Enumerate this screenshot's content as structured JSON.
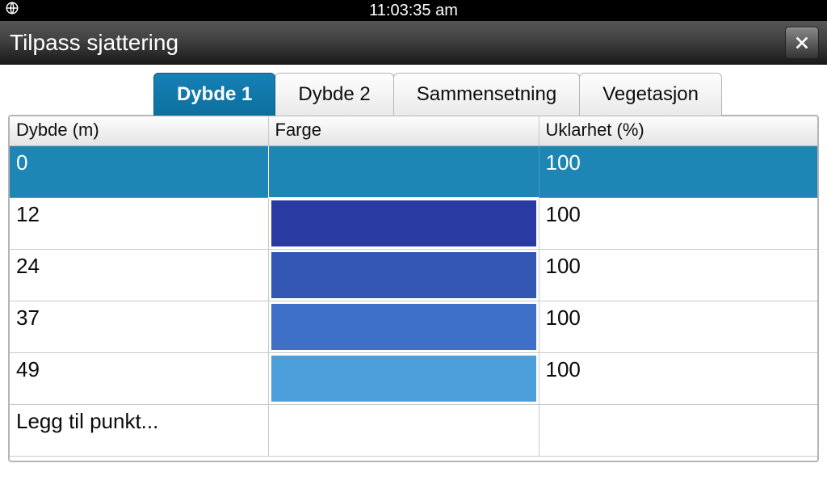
{
  "statusbar": {
    "time": "11:03:35 am"
  },
  "titlebar": {
    "title": "Tilpass sjattering"
  },
  "tabs": [
    {
      "label": "Dybde 1",
      "active": true
    },
    {
      "label": "Dybde 2",
      "active": false
    },
    {
      "label": "Sammensetning",
      "active": false
    },
    {
      "label": "Vegetasjon",
      "active": false
    }
  ],
  "columns": {
    "depth": "Dybde (m)",
    "color": "Farge",
    "opacity": "Uklarhet (%)"
  },
  "rows": [
    {
      "depth": "0",
      "color": "#1e86b5",
      "opacity": "100",
      "selected": true
    },
    {
      "depth": "12",
      "color": "#2a3aa3",
      "opacity": "100",
      "selected": false
    },
    {
      "depth": "24",
      "color": "#3557b4",
      "opacity": "100",
      "selected": false
    },
    {
      "depth": "37",
      "color": "#3f70c7",
      "opacity": "100",
      "selected": false
    },
    {
      "depth": "49",
      "color": "#4c9fdb",
      "opacity": "100",
      "selected": false
    }
  ],
  "addRow": {
    "label": "Legg til punkt..."
  }
}
